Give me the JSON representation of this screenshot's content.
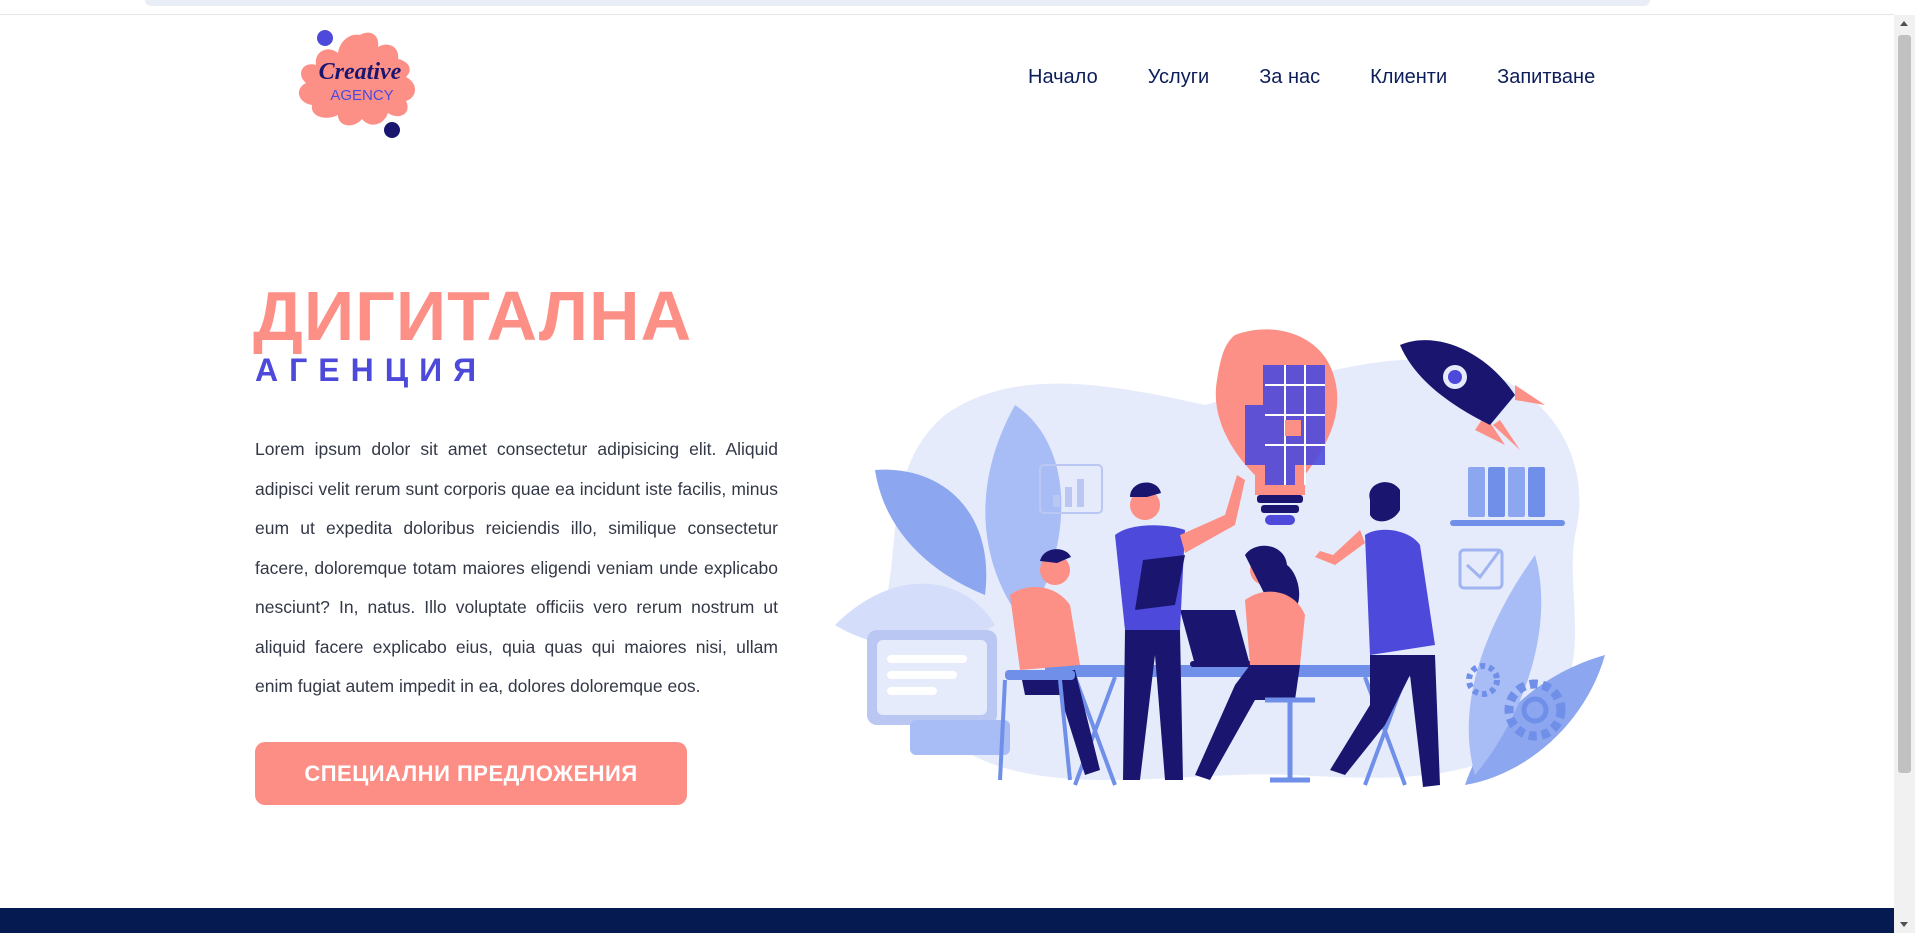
{
  "logo": {
    "line1": "Creative",
    "line2": "AGENCY"
  },
  "nav": {
    "items": [
      "Начало",
      "Услуги",
      "За нас",
      "Клиенти",
      "Запитване"
    ]
  },
  "hero": {
    "title": "ДИГИТАЛНА",
    "subtitle": "АГЕНЦИЯ",
    "paragraph": "Lorem ipsum dolor sit amet consectetur adipisicing elit. Aliquid adipisci velit rerum sunt corporis quae ea incidunt iste facilis, minus eum ut expedita doloribus reiciendis illo, similique consectetur facere, doloremque totam maiores eligendi veniam unde explicabo nesciunt? In, natus. Illo voluptate officiis vero rerum nostrum ut aliquid facere explicabo eius, quia quas qui maiores nisi, ullam enim fugiat autem impedit in ea, dolores doloremque eos.",
    "cta": "СПЕЦИАЛНИ ПРЕДЛОЖЕНИЯ"
  },
  "colors": {
    "accent": "#fc8f86",
    "secondary": "#4d4adb",
    "nav_text": "#0c1d5a",
    "footer": "#061a52"
  },
  "illustration": {
    "icons": [
      "lightbulb-puzzle-icon",
      "rocket-icon",
      "bar-chart-icon",
      "binders-icon",
      "checkbox-icon",
      "gear-icon"
    ]
  }
}
